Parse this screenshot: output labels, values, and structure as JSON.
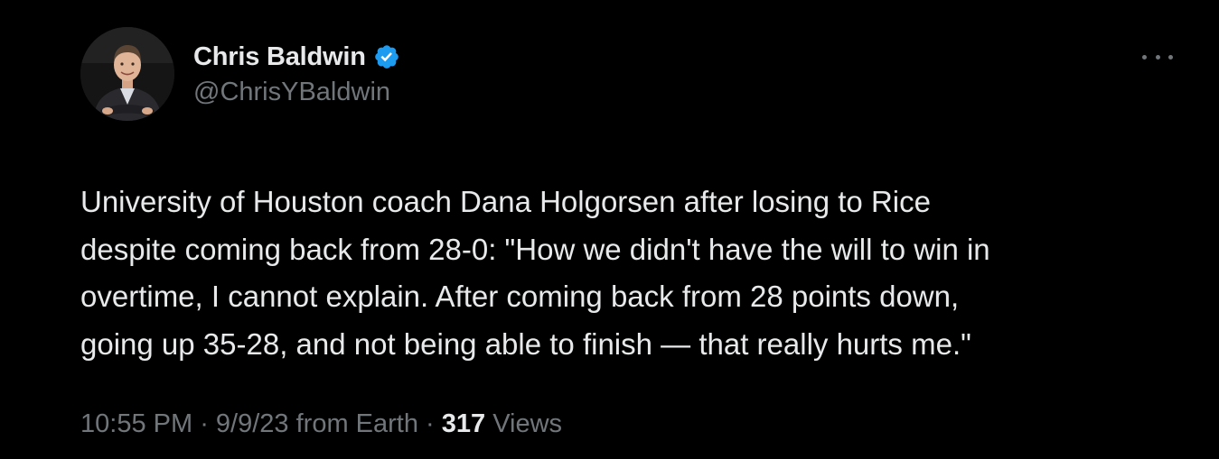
{
  "author": {
    "display_name": "Chris Baldwin",
    "handle": "@ChrisYBaldwin",
    "verified": true,
    "verified_color": "#1d9bf0",
    "avatar_icon": "profile-photo"
  },
  "menu": {
    "more_icon": "more-horizontal-icon"
  },
  "tweet": {
    "text": "University of Houston coach Dana Holgorsen after losing to Rice\ndespite coming back from 28-0: \"How we didn't have the will to win in\novertime, I cannot explain. After coming back from 28 points down,\ngoing up 35-28, and not being able to finish — that really hurts me.\""
  },
  "meta": {
    "time": "10:55 PM",
    "sep1": " · ",
    "date": "9/9/23",
    "source": " from Earth",
    "sep2": " · ",
    "views_count": "317",
    "views_label": " Views"
  },
  "colors": {
    "background": "#000000",
    "primary_text": "#e7e9ea",
    "secondary_text": "#71767b"
  }
}
